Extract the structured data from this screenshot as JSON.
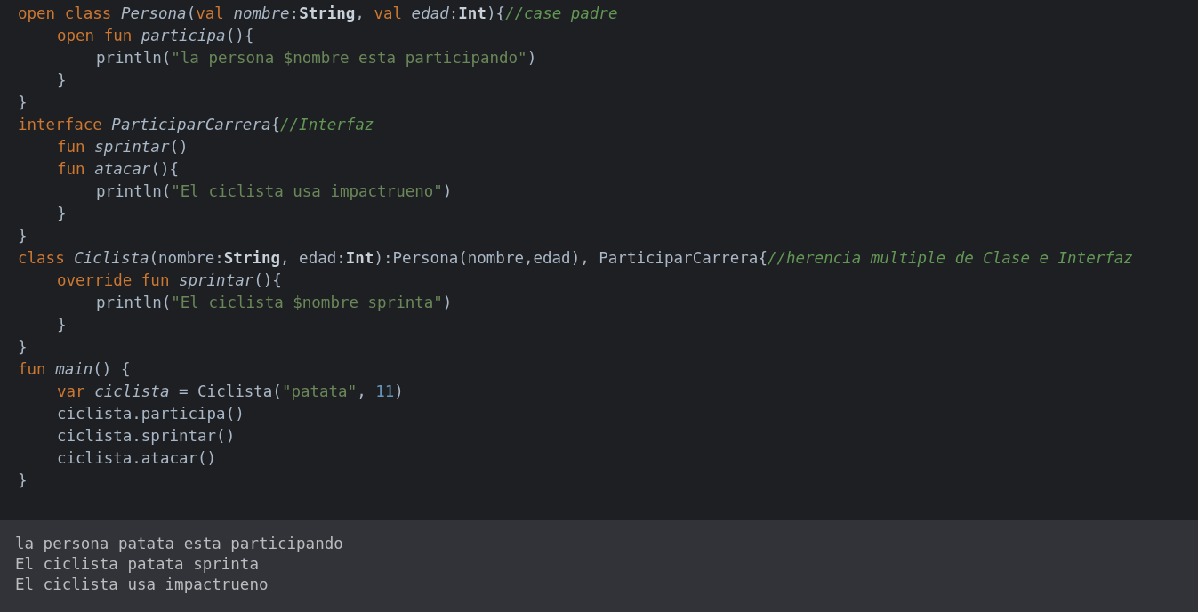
{
  "editor": {
    "lines": [
      {
        "tokens": [
          {
            "kind": "keyword",
            "text": "open class "
          },
          {
            "kind": "declaration",
            "text": "Persona"
          },
          {
            "kind": "plain",
            "text": "("
          },
          {
            "kind": "keyword",
            "text": "val "
          },
          {
            "kind": "declaration",
            "text": "nombre"
          },
          {
            "kind": "plain",
            "text": ":"
          },
          {
            "kind": "type",
            "text": "String"
          },
          {
            "kind": "plain",
            "text": ", "
          },
          {
            "kind": "keyword",
            "text": "val "
          },
          {
            "kind": "declaration",
            "text": "edad"
          },
          {
            "kind": "plain",
            "text": ":"
          },
          {
            "kind": "type",
            "text": "Int"
          },
          {
            "kind": "plain",
            "text": "){"
          },
          {
            "kind": "comment",
            "text": "//case padre"
          }
        ],
        "children": [
          {
            "tokens": [
              {
                "kind": "keyword",
                "text": "open fun "
              },
              {
                "kind": "declaration",
                "text": "participa"
              },
              {
                "kind": "plain",
                "text": "(){"
              }
            ],
            "children": [
              {
                "tokens": [
                  {
                    "kind": "plain",
                    "text": "println("
                  },
                  {
                    "kind": "string",
                    "text": "\"la persona $nombre esta participando\""
                  },
                  {
                    "kind": "plain",
                    "text": ")"
                  }
                ]
              }
            ]
          },
          {
            "tokens": [
              {
                "kind": "plain",
                "text": "}"
              }
            ]
          }
        ]
      },
      {
        "tokens": [
          {
            "kind": "plain",
            "text": "}"
          }
        ]
      },
      {
        "tokens": [
          {
            "kind": "keyword",
            "text": "interface "
          },
          {
            "kind": "declaration",
            "text": "ParticiparCarrera"
          },
          {
            "kind": "plain",
            "text": "{"
          },
          {
            "kind": "comment",
            "text": "//Interfaz"
          }
        ],
        "children": [
          {
            "tokens": [
              {
                "kind": "keyword",
                "text": "fun "
              },
              {
                "kind": "declaration",
                "text": "sprintar"
              },
              {
                "kind": "plain",
                "text": "()"
              }
            ]
          },
          {
            "tokens": [
              {
                "kind": "keyword",
                "text": "fun "
              },
              {
                "kind": "declaration",
                "text": "atacar"
              },
              {
                "kind": "plain",
                "text": "(){"
              }
            ],
            "children": [
              {
                "tokens": [
                  {
                    "kind": "plain",
                    "text": "println("
                  },
                  {
                    "kind": "string",
                    "text": "\"El ciclista usa impactrueno\""
                  },
                  {
                    "kind": "plain",
                    "text": ")"
                  }
                ]
              }
            ]
          },
          {
            "tokens": [
              {
                "kind": "plain",
                "text": "}"
              }
            ]
          }
        ]
      },
      {
        "tokens": [
          {
            "kind": "plain",
            "text": "}"
          }
        ]
      },
      {
        "tokens": [
          {
            "kind": "keyword",
            "text": "class "
          },
          {
            "kind": "declaration",
            "text": "Ciclista"
          },
          {
            "kind": "plain",
            "text": "(nombre:"
          },
          {
            "kind": "type",
            "text": "String"
          },
          {
            "kind": "plain",
            "text": ", edad:"
          },
          {
            "kind": "type",
            "text": "Int"
          },
          {
            "kind": "plain",
            "text": "):Persona(nombre,edad), ParticiparCarrera{"
          },
          {
            "kind": "comment",
            "text": "//herencia multiple de Clase e Interfaz"
          }
        ],
        "children": [
          {
            "tokens": [
              {
                "kind": "keyword",
                "text": "override fun "
              },
              {
                "kind": "declaration",
                "text": "sprintar"
              },
              {
                "kind": "plain",
                "text": "(){"
              }
            ],
            "children": [
              {
                "tokens": [
                  {
                    "kind": "plain",
                    "text": "println("
                  },
                  {
                    "kind": "string",
                    "text": "\"El ciclista $nombre sprinta\""
                  },
                  {
                    "kind": "plain",
                    "text": ")"
                  }
                ]
              }
            ]
          },
          {
            "tokens": [
              {
                "kind": "plain",
                "text": "}"
              }
            ]
          }
        ]
      },
      {
        "tokens": [
          {
            "kind": "plain",
            "text": "}"
          }
        ]
      },
      {
        "tokens": [
          {
            "kind": "keyword",
            "text": "fun "
          },
          {
            "kind": "declaration",
            "text": "main"
          },
          {
            "kind": "plain",
            "text": "() {"
          }
        ],
        "children": [
          {
            "tokens": [
              {
                "kind": "keyword",
                "text": "var "
              },
              {
                "kind": "declaration",
                "text": "ciclista"
              },
              {
                "kind": "plain",
                "text": " = Ciclista("
              },
              {
                "kind": "string",
                "text": "\"patata\""
              },
              {
                "kind": "plain",
                "text": ", "
              },
              {
                "kind": "number",
                "text": "11"
              },
              {
                "kind": "plain",
                "text": ")"
              }
            ]
          },
          {
            "tokens": [
              {
                "kind": "plain",
                "text": "ciclista.participa()"
              }
            ]
          },
          {
            "tokens": [
              {
                "kind": "plain",
                "text": "ciclista.sprintar()"
              }
            ]
          },
          {
            "tokens": [
              {
                "kind": "plain",
                "text": "ciclista.atacar()"
              }
            ]
          }
        ]
      },
      {
        "tokens": [
          {
            "kind": "plain",
            "text": "}"
          }
        ]
      }
    ]
  },
  "output": {
    "lines": [
      "la persona patata esta participando",
      "El ciclista patata sprinta",
      "El ciclista usa impactrueno"
    ]
  }
}
